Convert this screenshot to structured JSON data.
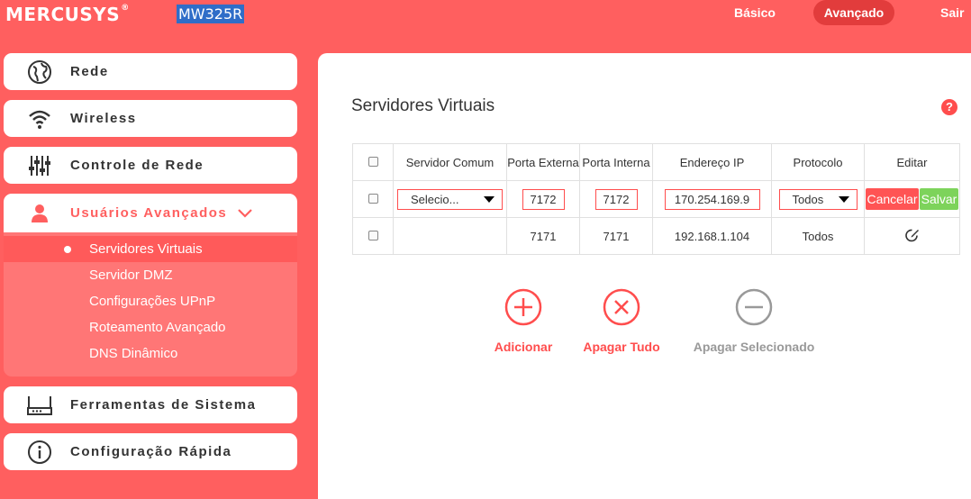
{
  "header": {
    "brand": "MERCUSYS",
    "model": "MW325R",
    "nav": {
      "basic": "Básico",
      "advanced": "Avançado",
      "exit": "Sair"
    }
  },
  "sidebar": {
    "items": [
      {
        "label": "Rede",
        "icon": "globe-icon"
      },
      {
        "label": "Wireless",
        "icon": "wifi-icon"
      },
      {
        "label": "Controle de Rede",
        "icon": "sliders-icon"
      },
      {
        "label": "Usuários Avançados",
        "icon": "user-icon"
      },
      {
        "label": "Ferramentas de Sistema",
        "icon": "router-icon"
      },
      {
        "label": "Configuração Rápida",
        "icon": "info-icon"
      }
    ],
    "submenu": [
      "Servidores Virtuais",
      "Servidor DMZ",
      "Configurações UPnP",
      "Roteamento Avançado",
      "DNS Dinâmico"
    ]
  },
  "main": {
    "title": "Servidores Virtuais",
    "help": "?",
    "table": {
      "headers": [
        "Servidor Comum",
        "Porta Externa",
        "Porta Interna",
        "Endereço IP",
        "Protocolo",
        "Editar"
      ],
      "edit_row": {
        "service": "Selecio...",
        "external_port": "7172",
        "internal_port": "7172",
        "ip": "170.254.169.9",
        "protocol": "Todos",
        "cancel": "Cancelar",
        "save": "Salvar"
      },
      "rows": [
        {
          "service": "",
          "external_port": "7171",
          "internal_port": "7171",
          "ip": "192.168.1.104",
          "protocol": "Todos"
        }
      ]
    },
    "actions": {
      "add": "Adicionar",
      "delete_all": "Apagar Tudo",
      "delete_selected": "Apagar Selecionado"
    }
  },
  "colors": {
    "accent": "#ff5f5f",
    "active_nav": "#e23c3c",
    "save": "#7dd35b",
    "disabled": "#999999"
  }
}
